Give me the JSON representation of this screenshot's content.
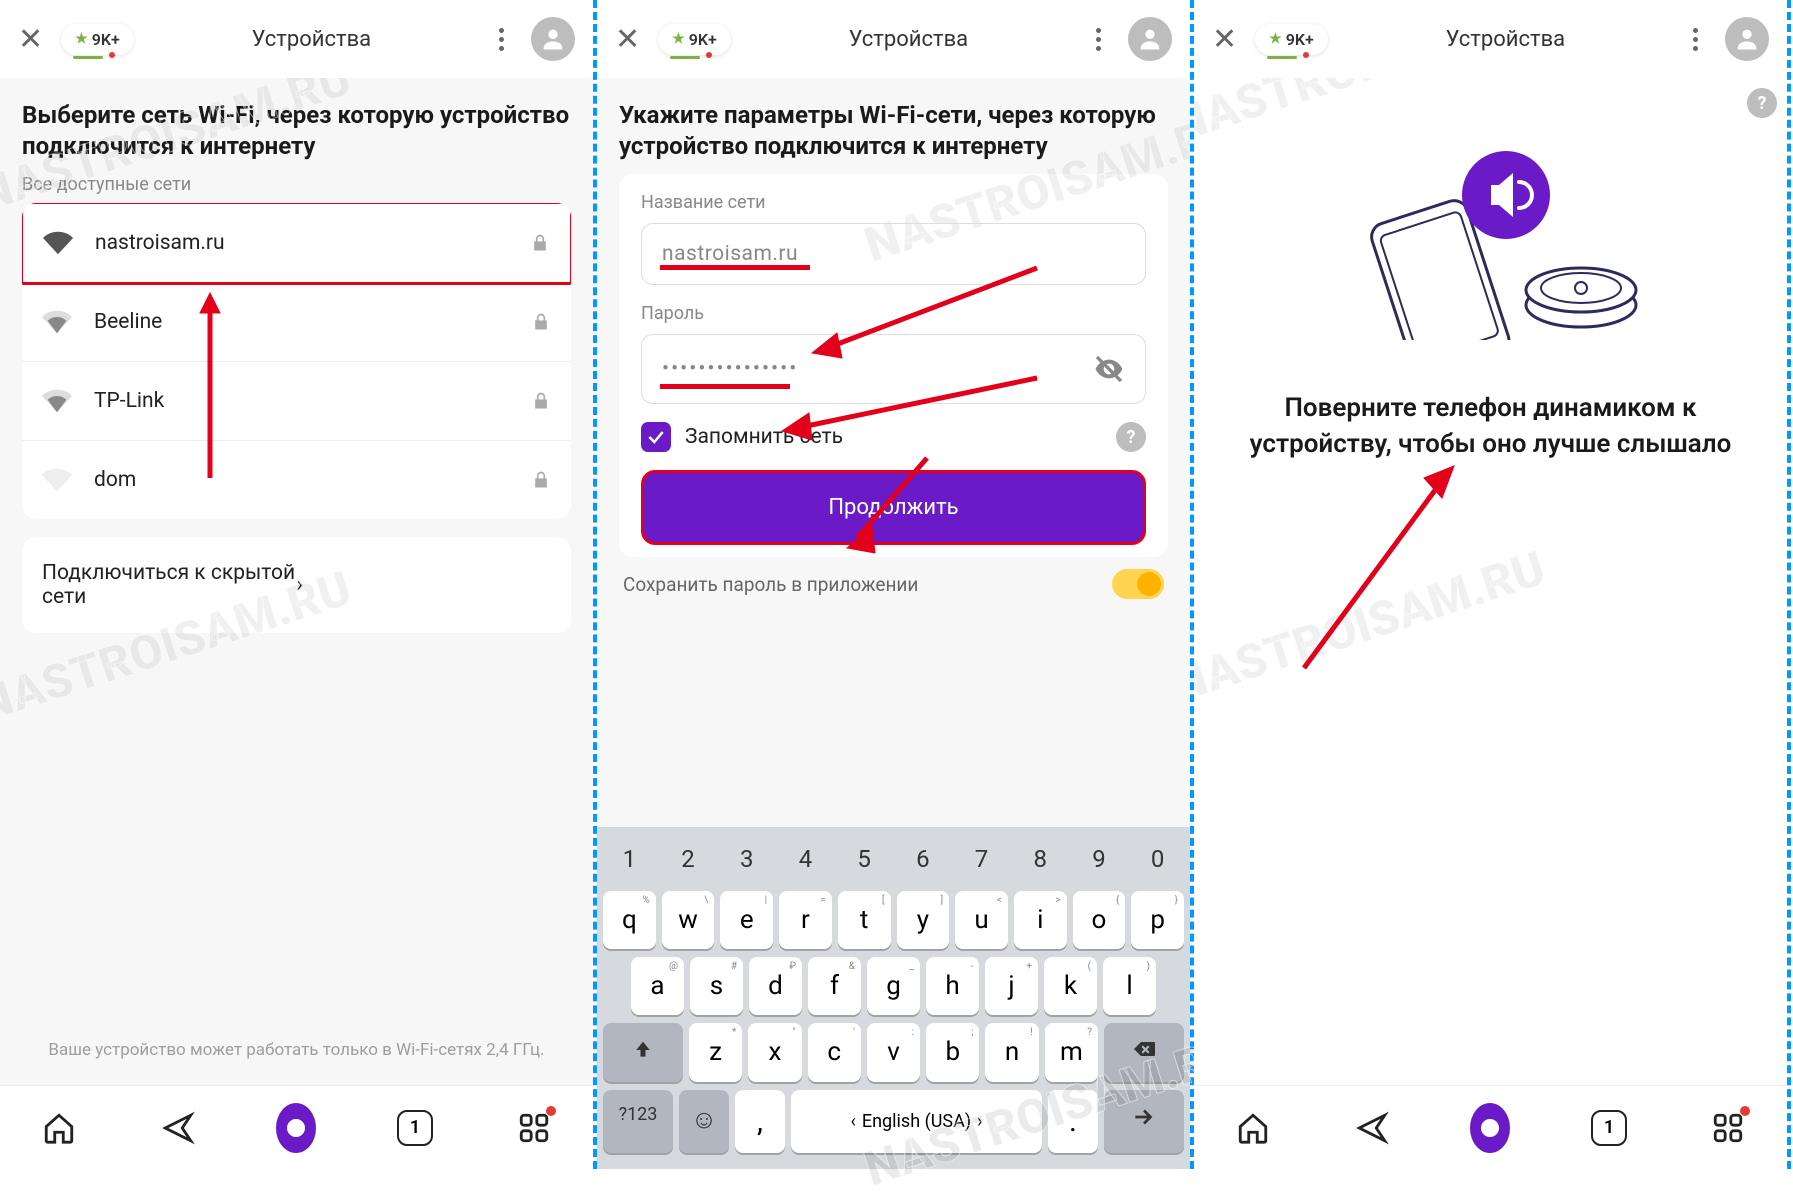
{
  "topbar": {
    "badge": "9K+",
    "title": "Устройства"
  },
  "screen1": {
    "heading": "Выберите сеть Wi-Fi, через которую устройство подключится к интернету",
    "all_label": "Все доступные сети",
    "networks": [
      {
        "name": "nastroisam.ru",
        "strength": "strong",
        "locked": true,
        "highlighted": true
      },
      {
        "name": "Beeline",
        "strength": "medium",
        "locked": true,
        "highlighted": false
      },
      {
        "name": "TP-Link",
        "strength": "medium",
        "locked": true,
        "highlighted": false
      },
      {
        "name": "dom",
        "strength": "weak",
        "locked": true,
        "highlighted": false
      }
    ],
    "hidden_label": "Подключиться к скрытой сети",
    "footnote": "Ваше устройство может работать только в Wi-Fi-сетях 2,4 ГГц."
  },
  "screen2": {
    "heading": "Укажите параметры Wi-Fi-сети, через которую устройство подключится к интернету",
    "name_label": "Название сети",
    "name_value": "nastroisam.ru",
    "pass_label": "Пароль",
    "pass_value": "•••••••••••••••",
    "remember": "Запомнить сеть",
    "continue": "Продолжить",
    "save_label": "Сохранить пароль в приложении",
    "keyboard": {
      "nums": [
        "1",
        "2",
        "3",
        "4",
        "5",
        "6",
        "7",
        "8",
        "9",
        "0"
      ],
      "row1": [
        "q",
        "w",
        "e",
        "r",
        "t",
        "y",
        "u",
        "i",
        "o",
        "p"
      ],
      "row1_hints": [
        "%",
        "\\",
        "|",
        "=",
        "[",
        "]",
        "<",
        ">",
        "{",
        "}"
      ],
      "row2": [
        "a",
        "s",
        "d",
        "f",
        "g",
        "h",
        "j",
        "k",
        "l"
      ],
      "row2_hints": [
        "@",
        "#",
        "₽",
        "&",
        "_",
        "-",
        "+",
        "(",
        ")"
      ],
      "row3": [
        "z",
        "x",
        "c",
        "v",
        "b",
        "n",
        "m"
      ],
      "row3_hints": [
        "*",
        "\"",
        "'",
        ":",
        ";",
        "!",
        "?"
      ],
      "mode": "?123",
      "lang": "English (USA)"
    }
  },
  "screen3": {
    "message": "Поверните телефон динамиком к устройству, чтобы оно лучше слышало"
  },
  "nav": {
    "tab_count": "1"
  },
  "watermark": "NASTROISAM.RU"
}
